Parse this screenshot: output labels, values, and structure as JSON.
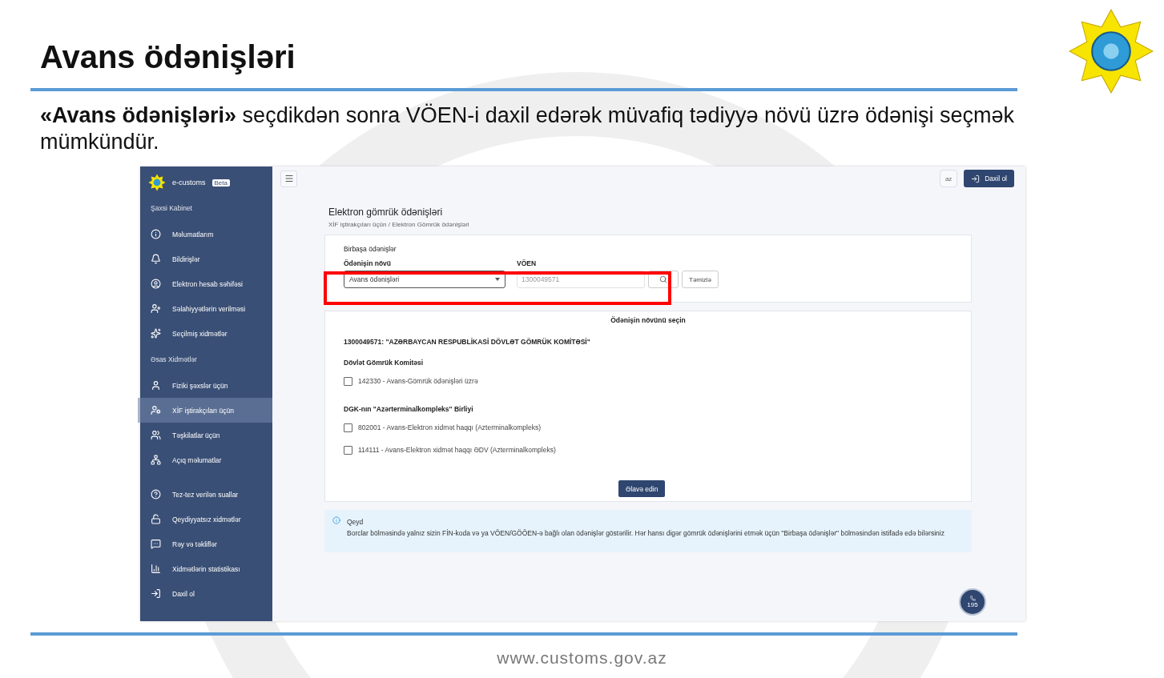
{
  "slide": {
    "title": "Avans ödənişləri",
    "intro": "**«Avans ödənişləri»** seçdikdən sonra VÖEN-i daxil edərək müvafiq tədiyyə növü üzrə ödənişi seçmək mümkündür.",
    "footer": "www.customs.gov.az"
  },
  "app": {
    "sidebar": {
      "brand": "e-customs",
      "badge": "Beta",
      "sections": [
        {
          "heading": "Şaxsi Kabinet",
          "items": [
            {
              "label": "Məlumatlarım",
              "selected": false
            },
            {
              "label": "Bildirişlər",
              "selected": false
            },
            {
              "label": "Elektron hesab səhifəsi",
              "selected": false
            },
            {
              "label": "Səlahiyyətlərin verilməsi",
              "selected": false
            },
            {
              "label": "Seçilmiş xidmətlər",
              "selected": false
            }
          ]
        },
        {
          "heading": "Əsas Xidmətlər",
          "items": [
            {
              "label": "Fiziki şəxslər üçün",
              "selected": false
            },
            {
              "label": "XİF iştirakçıları üçün",
              "selected": true
            },
            {
              "label": "Təşkilatlar üçün",
              "selected": false
            },
            {
              "label": "Açıq məlumatlar",
              "selected": false
            }
          ]
        },
        {
          "items": [
            {
              "label": "Tez-tez verilən suallar",
              "selected": false
            },
            {
              "label": "Qeydiyyatsız xidmətlər",
              "selected": false
            },
            {
              "label": "Rəy və təkliflər",
              "selected": false
            },
            {
              "label": "Xidmətlərin statistikası",
              "selected": false
            },
            {
              "label": "Daxil ol",
              "selected": false
            }
          ]
        }
      ]
    },
    "topbar": {
      "language": "az",
      "login": "Daxil ol"
    },
    "page_title": "Elektron gömrük ödənişləri",
    "breadcrumb": "XİF iştirakçıları üçün / Elektron Gömrük ödənişləri",
    "direct_payments": {
      "title": "Birbaşa ödənişlər",
      "type_label": "Ödənişin növü",
      "type_value": "Avans ödənişləri",
      "voen_label": "VÖEN",
      "voen_placeholder": "1300049571",
      "clear": "Təmizlə"
    },
    "choose": {
      "title": "Ödənişin növünü seçin",
      "organization": "1300049571: \"AZƏRBAYCAN RESPUBLİKASİ DÖVLƏT GÖMRÜK KOMİTƏSİ\"",
      "groups": [
        {
          "name": "Dövlət Gömrük Komitəsi",
          "options": [
            {
              "label": "142330 - Avans-Gömrük ödənişləri üzrə",
              "checked": false
            }
          ]
        },
        {
          "name": "DGK-nın \"Azərterminalkompleks\" Birliyi",
          "options": [
            {
              "label": "802001 - Avans-Elektron xidmət haqqı (Azterminalkompleks)",
              "checked": false
            },
            {
              "label": "114111 - Avans-Elektron xidmət haqqı ƏDV (Azterminalkompleks)",
              "checked": false
            }
          ]
        }
      ],
      "add": "Əlavə edin"
    },
    "note": {
      "title": "Qeyd",
      "text": "Borclar bölməsində yalnız sizin FİN-koda və ya VÖEN/GÖÖEN-ə bağlı olan ödənişlər göstərilir. Hər hansı digər gömrük ödənişlərini etmək üçün \"Birbaşa ödənişlər\" bölməsindən istifadə edə bilərsiniz"
    },
    "phone": "195"
  }
}
